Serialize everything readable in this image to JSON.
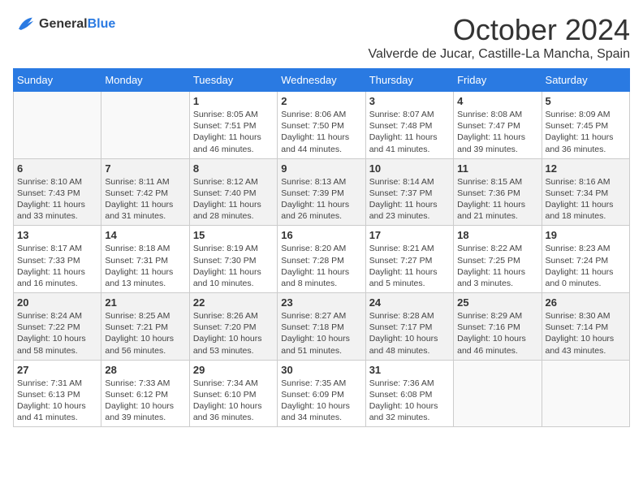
{
  "header": {
    "logo_line1": "General",
    "logo_line2": "Blue",
    "title": "October 2024",
    "subtitle": "Valverde de Jucar, Castille-La Mancha, Spain"
  },
  "days_of_week": [
    "Sunday",
    "Monday",
    "Tuesday",
    "Wednesday",
    "Thursday",
    "Friday",
    "Saturday"
  ],
  "weeks": [
    [
      {
        "day": "",
        "info": ""
      },
      {
        "day": "",
        "info": ""
      },
      {
        "day": "1",
        "info": "Sunrise: 8:05 AM\nSunset: 7:51 PM\nDaylight: 11 hours and 46 minutes."
      },
      {
        "day": "2",
        "info": "Sunrise: 8:06 AM\nSunset: 7:50 PM\nDaylight: 11 hours and 44 minutes."
      },
      {
        "day": "3",
        "info": "Sunrise: 8:07 AM\nSunset: 7:48 PM\nDaylight: 11 hours and 41 minutes."
      },
      {
        "day": "4",
        "info": "Sunrise: 8:08 AM\nSunset: 7:47 PM\nDaylight: 11 hours and 39 minutes."
      },
      {
        "day": "5",
        "info": "Sunrise: 8:09 AM\nSunset: 7:45 PM\nDaylight: 11 hours and 36 minutes."
      }
    ],
    [
      {
        "day": "6",
        "info": "Sunrise: 8:10 AM\nSunset: 7:43 PM\nDaylight: 11 hours and 33 minutes."
      },
      {
        "day": "7",
        "info": "Sunrise: 8:11 AM\nSunset: 7:42 PM\nDaylight: 11 hours and 31 minutes."
      },
      {
        "day": "8",
        "info": "Sunrise: 8:12 AM\nSunset: 7:40 PM\nDaylight: 11 hours and 28 minutes."
      },
      {
        "day": "9",
        "info": "Sunrise: 8:13 AM\nSunset: 7:39 PM\nDaylight: 11 hours and 26 minutes."
      },
      {
        "day": "10",
        "info": "Sunrise: 8:14 AM\nSunset: 7:37 PM\nDaylight: 11 hours and 23 minutes."
      },
      {
        "day": "11",
        "info": "Sunrise: 8:15 AM\nSunset: 7:36 PM\nDaylight: 11 hours and 21 minutes."
      },
      {
        "day": "12",
        "info": "Sunrise: 8:16 AM\nSunset: 7:34 PM\nDaylight: 11 hours and 18 minutes."
      }
    ],
    [
      {
        "day": "13",
        "info": "Sunrise: 8:17 AM\nSunset: 7:33 PM\nDaylight: 11 hours and 16 minutes."
      },
      {
        "day": "14",
        "info": "Sunrise: 8:18 AM\nSunset: 7:31 PM\nDaylight: 11 hours and 13 minutes."
      },
      {
        "day": "15",
        "info": "Sunrise: 8:19 AM\nSunset: 7:30 PM\nDaylight: 11 hours and 10 minutes."
      },
      {
        "day": "16",
        "info": "Sunrise: 8:20 AM\nSunset: 7:28 PM\nDaylight: 11 hours and 8 minutes."
      },
      {
        "day": "17",
        "info": "Sunrise: 8:21 AM\nSunset: 7:27 PM\nDaylight: 11 hours and 5 minutes."
      },
      {
        "day": "18",
        "info": "Sunrise: 8:22 AM\nSunset: 7:25 PM\nDaylight: 11 hours and 3 minutes."
      },
      {
        "day": "19",
        "info": "Sunrise: 8:23 AM\nSunset: 7:24 PM\nDaylight: 11 hours and 0 minutes."
      }
    ],
    [
      {
        "day": "20",
        "info": "Sunrise: 8:24 AM\nSunset: 7:22 PM\nDaylight: 10 hours and 58 minutes."
      },
      {
        "day": "21",
        "info": "Sunrise: 8:25 AM\nSunset: 7:21 PM\nDaylight: 10 hours and 56 minutes."
      },
      {
        "day": "22",
        "info": "Sunrise: 8:26 AM\nSunset: 7:20 PM\nDaylight: 10 hours and 53 minutes."
      },
      {
        "day": "23",
        "info": "Sunrise: 8:27 AM\nSunset: 7:18 PM\nDaylight: 10 hours and 51 minutes."
      },
      {
        "day": "24",
        "info": "Sunrise: 8:28 AM\nSunset: 7:17 PM\nDaylight: 10 hours and 48 minutes."
      },
      {
        "day": "25",
        "info": "Sunrise: 8:29 AM\nSunset: 7:16 PM\nDaylight: 10 hours and 46 minutes."
      },
      {
        "day": "26",
        "info": "Sunrise: 8:30 AM\nSunset: 7:14 PM\nDaylight: 10 hours and 43 minutes."
      }
    ],
    [
      {
        "day": "27",
        "info": "Sunrise: 7:31 AM\nSunset: 6:13 PM\nDaylight: 10 hours and 41 minutes."
      },
      {
        "day": "28",
        "info": "Sunrise: 7:33 AM\nSunset: 6:12 PM\nDaylight: 10 hours and 39 minutes."
      },
      {
        "day": "29",
        "info": "Sunrise: 7:34 AM\nSunset: 6:10 PM\nDaylight: 10 hours and 36 minutes."
      },
      {
        "day": "30",
        "info": "Sunrise: 7:35 AM\nSunset: 6:09 PM\nDaylight: 10 hours and 34 minutes."
      },
      {
        "day": "31",
        "info": "Sunrise: 7:36 AM\nSunset: 6:08 PM\nDaylight: 10 hours and 32 minutes."
      },
      {
        "day": "",
        "info": ""
      },
      {
        "day": "",
        "info": ""
      }
    ]
  ]
}
